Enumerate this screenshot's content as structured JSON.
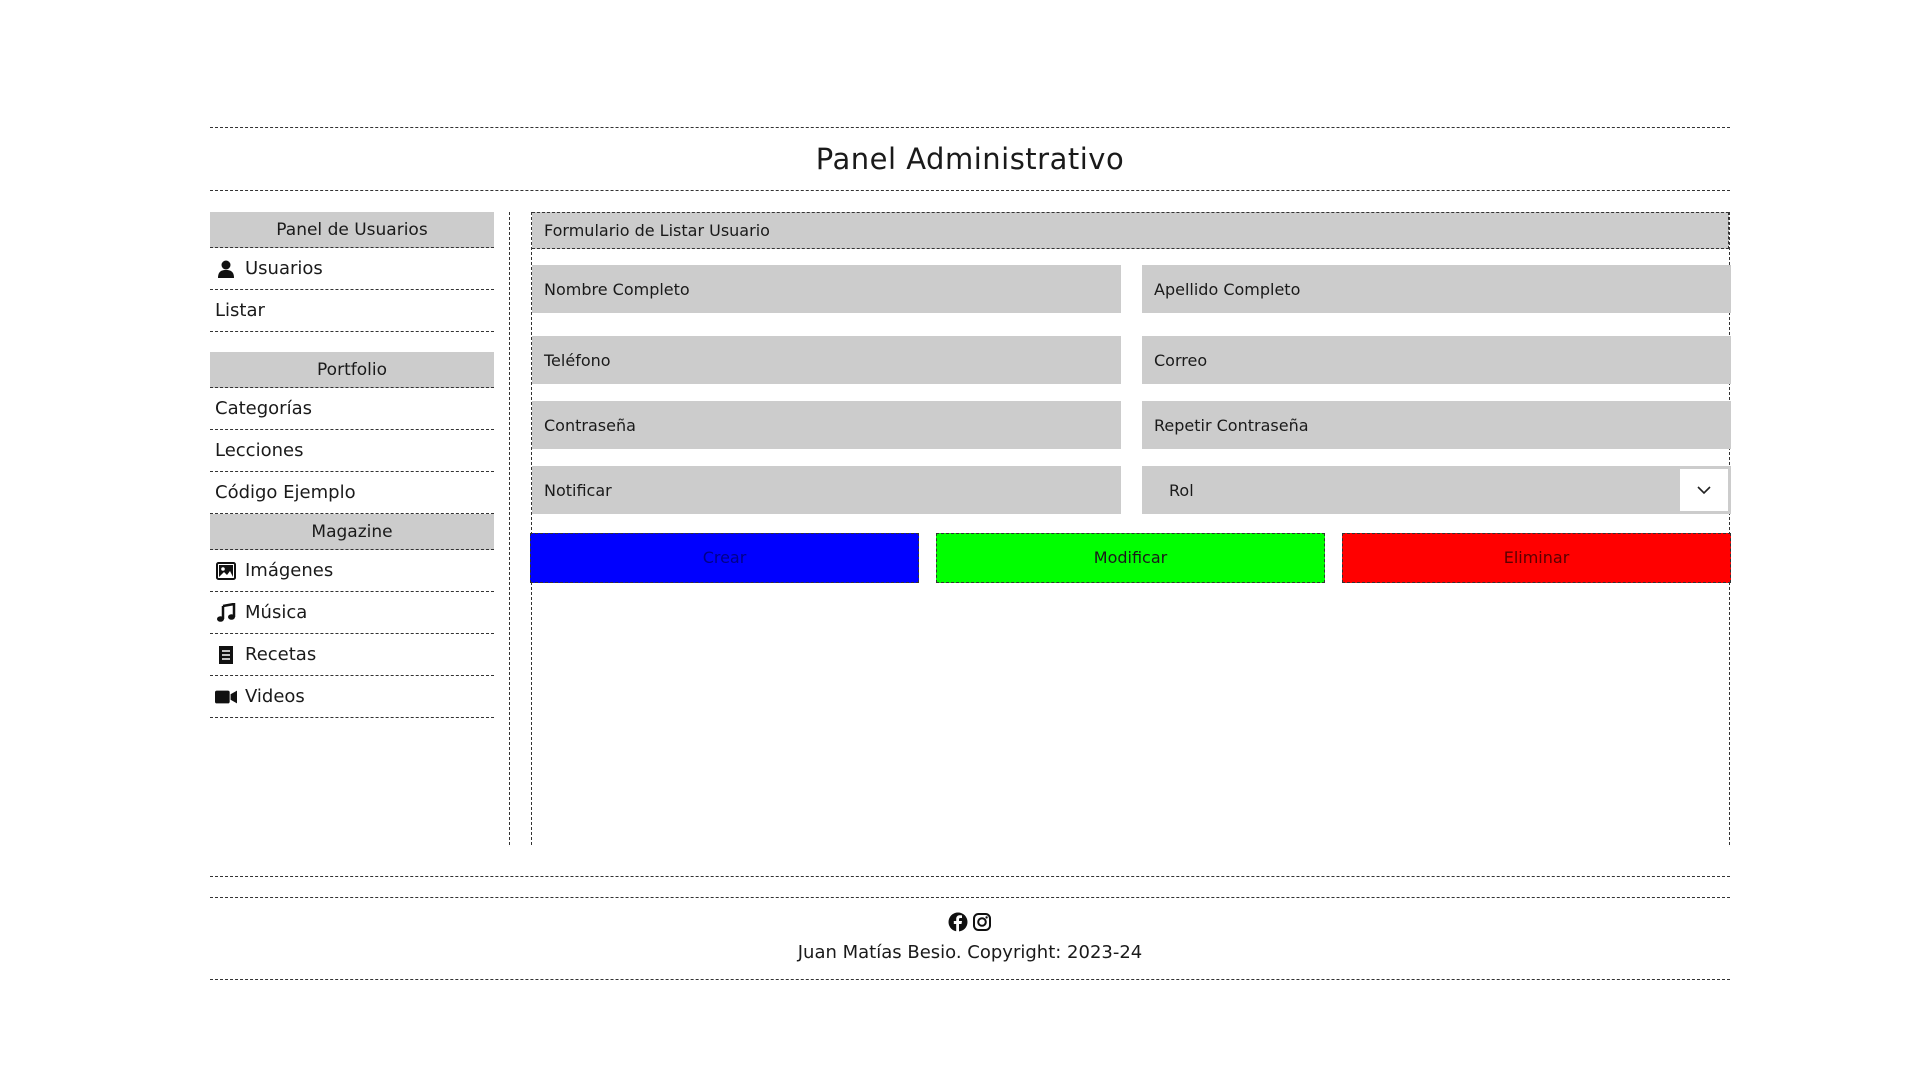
{
  "header": {
    "title": "Panel Administrativo"
  },
  "sidebar": {
    "sections": [
      {
        "title": "Panel de Usuarios",
        "items": [
          {
            "label": "Usuarios",
            "icon": "user-icon"
          },
          {
            "label": "Listar",
            "icon": ""
          }
        ]
      },
      {
        "title": "Portfolio",
        "items": [
          {
            "label": "Categorías",
            "icon": ""
          },
          {
            "label": "Lecciones",
            "icon": ""
          },
          {
            "label": "Código Ejemplo",
            "icon": ""
          }
        ]
      },
      {
        "title": "Magazine",
        "items": [
          {
            "label": "Imágenes",
            "icon": "image-icon"
          },
          {
            "label": "Música",
            "icon": "music-icon"
          },
          {
            "label": "Recetas",
            "icon": "receipt-icon"
          },
          {
            "label": "Videos",
            "icon": "video-icon"
          }
        ]
      }
    ]
  },
  "form": {
    "title": "Formulario de Listar Usuario",
    "fields": {
      "nombre": "Nombre Completo",
      "apellido": "Apellido Completo",
      "telefono": "Teléfono",
      "correo": "Correo",
      "contrasena": "Contraseña",
      "repetir": "Repetir Contraseña",
      "notificar": "Notificar",
      "rol": "Rol"
    },
    "buttons": {
      "crear": "Crear",
      "modificar": "Modificar",
      "eliminar": "Eliminar"
    },
    "colors": {
      "crear": "#0000ff",
      "modificar": "#00ff00",
      "eliminar": "#ff0000",
      "field_bg": "#cccccc"
    }
  },
  "footer": {
    "icons": [
      "facebook-icon",
      "instagram-icon"
    ],
    "copyright": "Juan Matías Besio. Copyright: 2023-24"
  }
}
